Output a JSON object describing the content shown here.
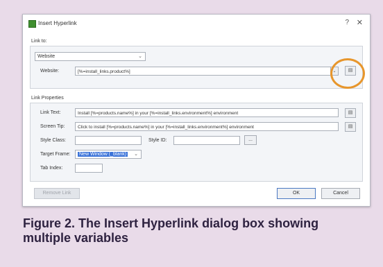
{
  "dialog": {
    "title": "Insert Hyperlink",
    "help_label": "?",
    "close_label": "✕",
    "link_to": {
      "group_label": "Link to:",
      "type_value": "Website",
      "website_label": "Website:",
      "website_value": "[%=install_links.product%]"
    },
    "properties": {
      "group_label": "Link Properties",
      "link_text_label": "Link Text:",
      "link_text_value": "Install [%=products.name%] in your [%=install_links.environment%] environment",
      "screen_tip_label": "Screen Tip:",
      "screen_tip_value": "Click to install [%=products.name%] in your [%=install_links.environment%] environment",
      "style_class_label": "Style Class:",
      "style_class_value": "",
      "style_id_label": "Style ID:",
      "style_id_value": "",
      "browse_label": "...",
      "target_frame_label": "Target Frame:",
      "target_frame_value": "New Window (_blank)",
      "tab_index_label": "Tab Index:",
      "tab_index_value": ""
    },
    "buttons": {
      "remove_link": "Remove Link",
      "ok": "OK",
      "cancel": "Cancel"
    }
  },
  "caption": "Figure 2. The Insert Hyperlink dialog box showing multiple variables",
  "colors": {
    "background": "#e9dbe9",
    "highlight_ring": "#e7962c",
    "caption_text": "#2e2240"
  }
}
